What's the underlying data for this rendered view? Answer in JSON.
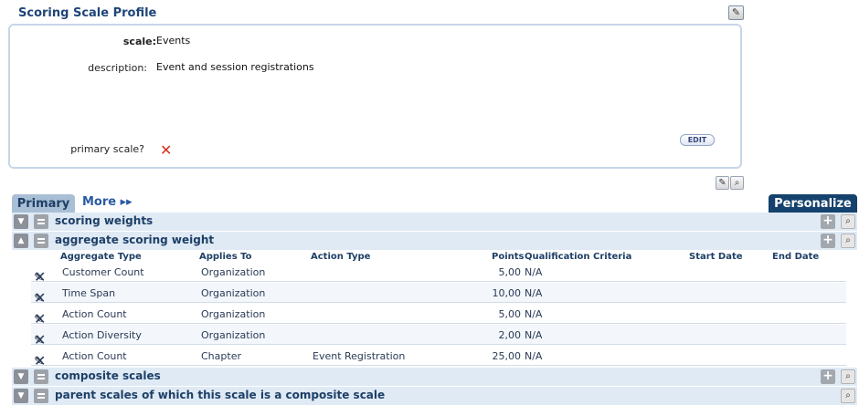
{
  "profile": {
    "title": "Scoring Scale Profile",
    "fields": {
      "scale_label": "scale:",
      "scale_value": "Events",
      "description_label": "description:",
      "description_value": "Event and session registrations",
      "primary_label": "primary scale?"
    },
    "edit_button": "EDIT"
  },
  "tabs": {
    "primary": "Primary",
    "more": "More ▸▸",
    "personalize": "Personalize"
  },
  "sections": {
    "scoring_weights": "scoring weights",
    "aggregate_scoring_weight": "aggregate scoring weight",
    "composite_scales": "composite scales",
    "parent_scales": "parent scales of which this scale is a composite scale"
  },
  "grid": {
    "headers": [
      "Aggregate Type",
      "Applies To",
      "Action Type",
      "Points",
      "Qualification Criteria",
      "Start Date",
      "End Date"
    ],
    "rows": [
      {
        "aggregate_type": "Customer Count",
        "applies_to": "Organization",
        "action_type": "",
        "points": "5,00",
        "criteria": "N/A"
      },
      {
        "aggregate_type": "Time Span",
        "applies_to": "Organization",
        "action_type": "",
        "points": "10,00",
        "criteria": "N/A"
      },
      {
        "aggregate_type": "Action Count",
        "applies_to": "Organization",
        "action_type": "",
        "points": "5,00",
        "criteria": "N/A"
      },
      {
        "aggregate_type": "Action Diversity",
        "applies_to": "Organization",
        "action_type": "",
        "points": "2,00",
        "criteria": "N/A"
      },
      {
        "aggregate_type": "Action Count",
        "applies_to": "Chapter",
        "action_type": "Event Registration",
        "points": "25,00",
        "criteria": "N/A"
      }
    ]
  },
  "colors": {
    "accent": "#15426d",
    "delete": "#d8321f",
    "edit": "#bf5a1a"
  }
}
